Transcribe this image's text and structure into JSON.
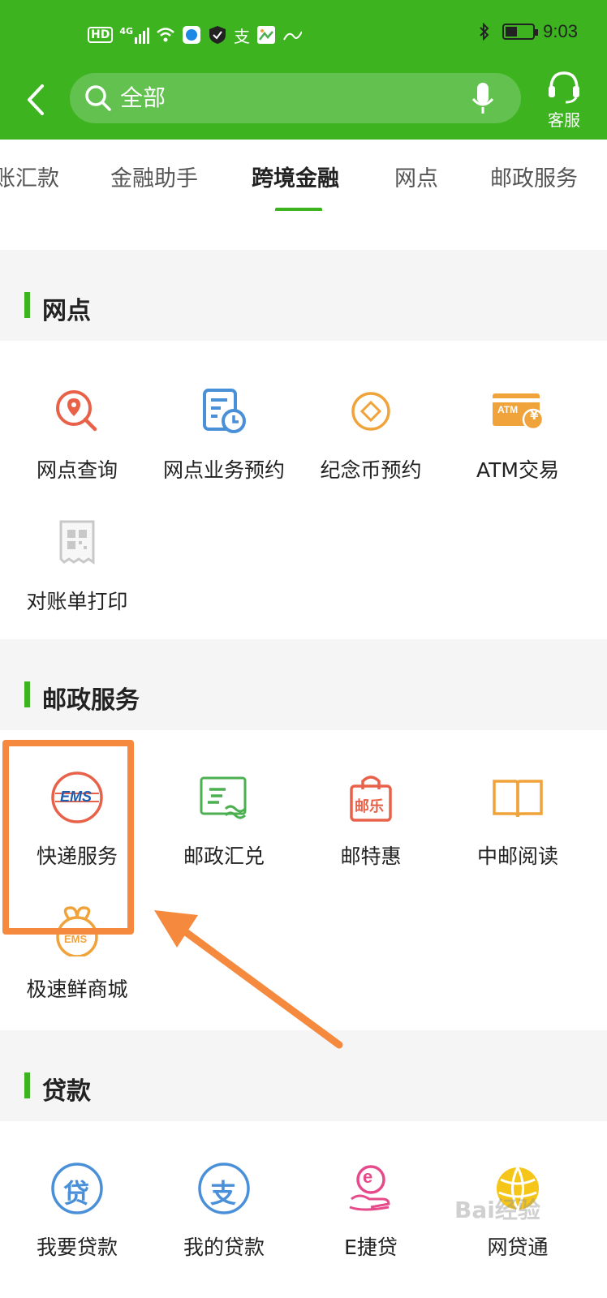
{
  "status_bar": {
    "hd": "HD",
    "network": "4G",
    "alipay_glyph": "支",
    "time": "9:03",
    "battery_level": 0.45
  },
  "header": {
    "search_placeholder": "全部",
    "service_label": "客服"
  },
  "tabs": [
    "账汇款",
    "金融助手",
    "跨境金融",
    "网点",
    "邮政服务"
  ],
  "active_tab": "跨境金融",
  "sections": {
    "branch": {
      "title": "网点",
      "items": [
        {
          "label": "网点查询",
          "icon": "location-search-icon"
        },
        {
          "label": "网点业务预约",
          "icon": "appointment-doc-icon"
        },
        {
          "label": "纪念币预约",
          "icon": "coin-icon"
        },
        {
          "label": "ATM交易",
          "icon": "atm-card-icon",
          "icon_text": "ATM",
          "icon_symbol": "¥"
        },
        {
          "label": "对账单打印",
          "icon": "receipt-qr-icon"
        }
      ]
    },
    "postal": {
      "title": "邮政服务",
      "items": [
        {
          "label": "快递服务",
          "icon": "ems-icon",
          "icon_text": "EMS"
        },
        {
          "label": "邮政汇兑",
          "icon": "remittance-icon"
        },
        {
          "label": "邮特惠",
          "icon": "shopping-bag-icon",
          "icon_text": "邮乐"
        },
        {
          "label": "中邮阅读",
          "icon": "open-book-icon"
        },
        {
          "label": "极速鲜商城",
          "icon": "ems-gift-icon",
          "icon_text": "EMS"
        }
      ]
    },
    "loan": {
      "title": "贷款",
      "items": [
        {
          "label": "我要贷款",
          "icon": "loan-icon",
          "icon_text": "贷"
        },
        {
          "label": "我的贷款",
          "icon": "my-loan-icon",
          "icon_text": "支"
        },
        {
          "label": "E捷贷",
          "icon": "e-loan-icon",
          "icon_text": "e"
        },
        {
          "label": "网贷通",
          "icon": "globe-icon"
        }
      ]
    }
  },
  "watermark": "Bai经验",
  "colors": {
    "brand_green": "#3cb31f",
    "highlight_orange": "#f5893d",
    "icon_red": "#e8624a",
    "icon_blue": "#4a90d9",
    "icon_orange": "#f0a33a",
    "icon_green": "#4caf50"
  }
}
